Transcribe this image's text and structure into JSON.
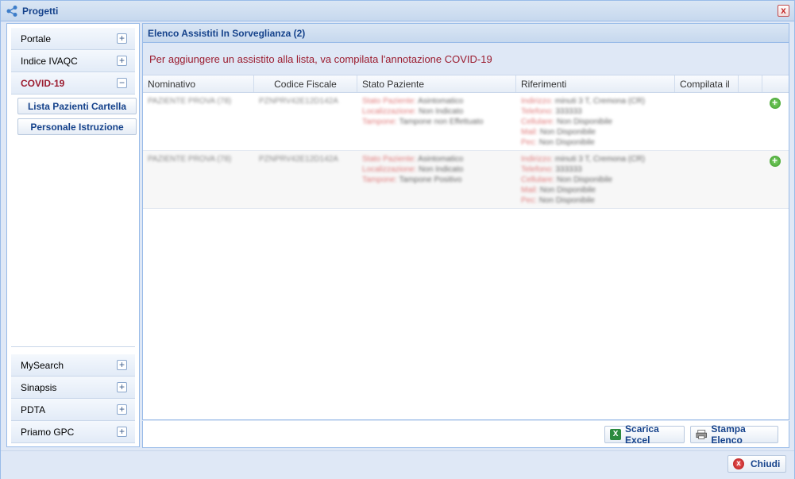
{
  "window": {
    "title": "Progetti",
    "close_glyph": "x"
  },
  "sidebar": {
    "top_items": [
      {
        "label": "Portale",
        "toggle": "+"
      },
      {
        "label": "Indice IVAQC",
        "toggle": "+"
      },
      {
        "label": "COVID-19",
        "toggle": "−",
        "active": true
      }
    ],
    "covid_sub_buttons": [
      {
        "label": "Lista Pazienti Cartella"
      },
      {
        "label": "Personale Istruzione"
      }
    ],
    "bottom_items": [
      {
        "label": "MySearch",
        "toggle": "+"
      },
      {
        "label": "Sinapsis",
        "toggle": "+"
      },
      {
        "label": "PDTA",
        "toggle": "+"
      },
      {
        "label": "Priamo GPC",
        "toggle": "+"
      }
    ]
  },
  "main": {
    "panel_title": "Elenco Assistiti In Sorveglianza (2)",
    "info_message": "Per aggiungere un assistito alla lista, va compilata l'annotazione COVID-19",
    "columns": [
      "Nominativo",
      "Codice Fiscale",
      "Stato Paziente",
      "Riferimenti",
      "Compilata il",
      ""
    ],
    "rows": [
      {
        "nominativo": "PAZIENTE PROVA (78)",
        "codice_fiscale": "PZNPRV42E12D142A",
        "stato": [
          {
            "label": "Stato Paziente:",
            "value": "Asintomatico"
          },
          {
            "label": "Localizzazione:",
            "value": "Non Indicato"
          },
          {
            "label": "Tampone:",
            "value": "Tampone non Effettuato"
          }
        ],
        "riferimenti": [
          {
            "label": "Indirizzo:",
            "value": "minuti 3 T, Cremona (CR)"
          },
          {
            "label": "Telefono:",
            "value": "333333"
          },
          {
            "label": "Cellulare:",
            "value": "Non Disponibile"
          },
          {
            "label": "Mail:",
            "value": "Non Disponibile"
          },
          {
            "label": "Pec:",
            "value": "Non Disponibile"
          }
        ],
        "compilata_il": "",
        "add_glyph": "+"
      },
      {
        "nominativo": "PAZIENTE PROVA (78)",
        "codice_fiscale": "PZNPRV42E12D142A",
        "stato": [
          {
            "label": "Stato Paziente:",
            "value": "Asintomatico"
          },
          {
            "label": "Localizzazione:",
            "value": "Non Indicato"
          },
          {
            "label": "Tampone:",
            "value": "Tampone Positivo"
          }
        ],
        "riferimenti": [
          {
            "label": "Indirizzo:",
            "value": "minuti 3 T, Cremona (CR)"
          },
          {
            "label": "Telefono:",
            "value": "333333"
          },
          {
            "label": "Cellulare:",
            "value": "Non Disponibile"
          },
          {
            "label": "Mail:",
            "value": "Non Disponibile"
          },
          {
            "label": "Pec:",
            "value": "Non Disponibile"
          }
        ],
        "compilata_il": "",
        "add_glyph": "+"
      }
    ]
  },
  "footer": {
    "excel_label": "Scarica Excel",
    "excel_icon_glyph": "X",
    "print_label": "Stampa Elenco",
    "close_label": "Chiudi",
    "close_icon_glyph": "x"
  },
  "colors": {
    "accent_red": "#9b1b2e",
    "header_blue": "#15428b",
    "border_blue": "#99bbe8"
  }
}
